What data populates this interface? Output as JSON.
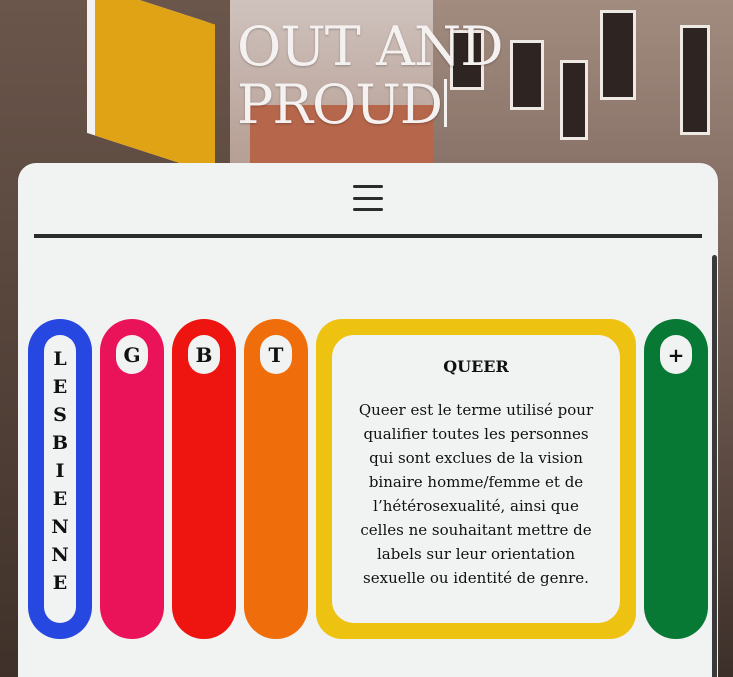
{
  "hero": {
    "title_line1": "OUT AND",
    "title_line2": "PROUD"
  },
  "nav": {
    "menu_icon": "hamburger-menu-icon"
  },
  "letters": [
    {
      "label": "LESBIENNE",
      "color": "#2648e0"
    },
    {
      "label": "G",
      "color": "#ea135a"
    },
    {
      "label": "B",
      "color": "#ee140f"
    },
    {
      "label": "T",
      "color": "#ef6e0b"
    }
  ],
  "queer": {
    "heading": "QUEER",
    "text": "Queer est le terme utilisé pour qualifier toutes les personnes qui sont exclues de la vision binaire homme/femme et de l’hétérosexualité, ainsi que celles ne souhaitant mettre de labels sur leur orientation sexuelle ou identité de genre.",
    "color": "#eec211"
  },
  "plus": {
    "label": "+",
    "color": "#087935"
  }
}
